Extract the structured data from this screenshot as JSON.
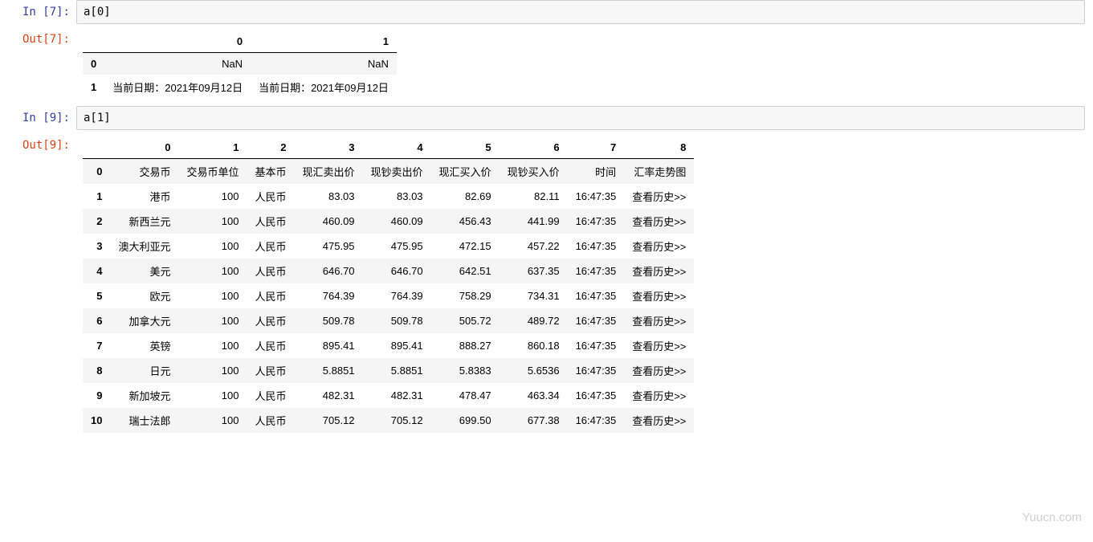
{
  "cells": [
    {
      "in_prompt": "In  [7]:",
      "out_prompt": "Out[7]:",
      "code": "a[0]",
      "table": {
        "columns": [
          "",
          "0",
          "1"
        ],
        "rows": [
          [
            "0",
            "NaN",
            "NaN"
          ],
          [
            "1",
            "当前日期：2021年09月12日",
            "当前日期：2021年09月12日"
          ]
        ]
      }
    },
    {
      "in_prompt": "In  [9]:",
      "out_prompt": "Out[9]:",
      "code": "a[1]",
      "table": {
        "columns": [
          "",
          "0",
          "1",
          "2",
          "3",
          "4",
          "5",
          "6",
          "7",
          "8"
        ],
        "rows": [
          [
            "0",
            "交易币",
            "交易币单位",
            "基本币",
            "现汇卖出价",
            "现钞卖出价",
            "现汇买入价",
            "现钞买入价",
            "时间",
            "汇率走势图"
          ],
          [
            "1",
            "港币",
            "100",
            "人民币",
            "83.03",
            "83.03",
            "82.69",
            "82.11",
            "16:47:35",
            "查看历史>>"
          ],
          [
            "2",
            "新西兰元",
            "100",
            "人民币",
            "460.09",
            "460.09",
            "456.43",
            "441.99",
            "16:47:35",
            "查看历史>>"
          ],
          [
            "3",
            "澳大利亚元",
            "100",
            "人民币",
            "475.95",
            "475.95",
            "472.15",
            "457.22",
            "16:47:35",
            "查看历史>>"
          ],
          [
            "4",
            "美元",
            "100",
            "人民币",
            "646.70",
            "646.70",
            "642.51",
            "637.35",
            "16:47:35",
            "查看历史>>"
          ],
          [
            "5",
            "欧元",
            "100",
            "人民币",
            "764.39",
            "764.39",
            "758.29",
            "734.31",
            "16:47:35",
            "查看历史>>"
          ],
          [
            "6",
            "加拿大元",
            "100",
            "人民币",
            "509.78",
            "509.78",
            "505.72",
            "489.72",
            "16:47:35",
            "查看历史>>"
          ],
          [
            "7",
            "英镑",
            "100",
            "人民币",
            "895.41",
            "895.41",
            "888.27",
            "860.18",
            "16:47:35",
            "查看历史>>"
          ],
          [
            "8",
            "日元",
            "100",
            "人民币",
            "5.8851",
            "5.8851",
            "5.8383",
            "5.6536",
            "16:47:35",
            "查看历史>>"
          ],
          [
            "9",
            "新加坡元",
            "100",
            "人民币",
            "482.31",
            "482.31",
            "478.47",
            "463.34",
            "16:47:35",
            "查看历史>>"
          ],
          [
            "10",
            "瑞士法郎",
            "100",
            "人民币",
            "705.12",
            "705.12",
            "699.50",
            "677.38",
            "16:47:35",
            "查看历史>>"
          ]
        ]
      }
    }
  ],
  "watermark": "Yuucn.com"
}
